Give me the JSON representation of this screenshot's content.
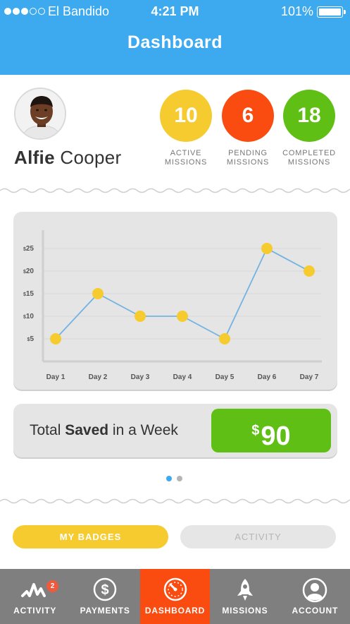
{
  "status_bar": {
    "carrier": "El Bandido",
    "time": "4:21 PM",
    "battery": "101%"
  },
  "header": {
    "title": "Dashboard"
  },
  "profile": {
    "first_name": "Alfie",
    "last_name": "Cooper",
    "missions": [
      {
        "value": "10",
        "label_line1": "ACTIVE",
        "label_line2": "MISSIONS",
        "color": "#f6cb2f"
      },
      {
        "value": "6",
        "label_line1": "PENDING",
        "label_line2": "MISSIONS",
        "color": "#fa4b10"
      },
      {
        "value": "18",
        "label_line1": "COMPLETED",
        "label_line2": "MISSIONS",
        "color": "#5fbf14"
      }
    ]
  },
  "chart_data": {
    "type": "line",
    "categories": [
      "Day 1",
      "Day 2",
      "Day 3",
      "Day 4",
      "Day 5",
      "Day 6",
      "Day 7"
    ],
    "series": [
      {
        "values": [
          5,
          15,
          10,
          10,
          5,
          25,
          20
        ]
      }
    ],
    "yticks": [
      5,
      10,
      15,
      20,
      25
    ],
    "ytick_labels": [
      "$5",
      "$10",
      "$15",
      "$20",
      "$25"
    ],
    "ylim": [
      0,
      25
    ],
    "title": "",
    "xlabel": "",
    "ylabel": "",
    "grid": true,
    "line_color": "#74b3e0",
    "marker_color": "#f6cb2f"
  },
  "total": {
    "label_pre": "Total ",
    "label_bold": "Saved",
    "label_post": " in a Week",
    "currency": "$",
    "amount": "90"
  },
  "pager": {
    "pages": 2,
    "active": 1
  },
  "segments": {
    "badges": "MY BADGES",
    "activity": "ACTIVITY",
    "active": "badges"
  },
  "tabbar": {
    "tabs": [
      {
        "label": "ACTIVITY",
        "icon": "activity-icon",
        "badge": "2"
      },
      {
        "label": "PAYMENTS",
        "icon": "dollar-icon"
      },
      {
        "label": "DASHBOARD",
        "icon": "speedometer-icon",
        "active": true
      },
      {
        "label": "MISSIONS",
        "icon": "rocket-icon"
      },
      {
        "label": "ACCOUNT",
        "icon": "user-icon"
      }
    ]
  },
  "colors": {
    "header_blue": "#3daaf0",
    "accent_yellow": "#f6cb2f",
    "accent_orange": "#fa4b10",
    "accent_green": "#5fbf14",
    "tabbar_gray": "#7f7f7f"
  }
}
